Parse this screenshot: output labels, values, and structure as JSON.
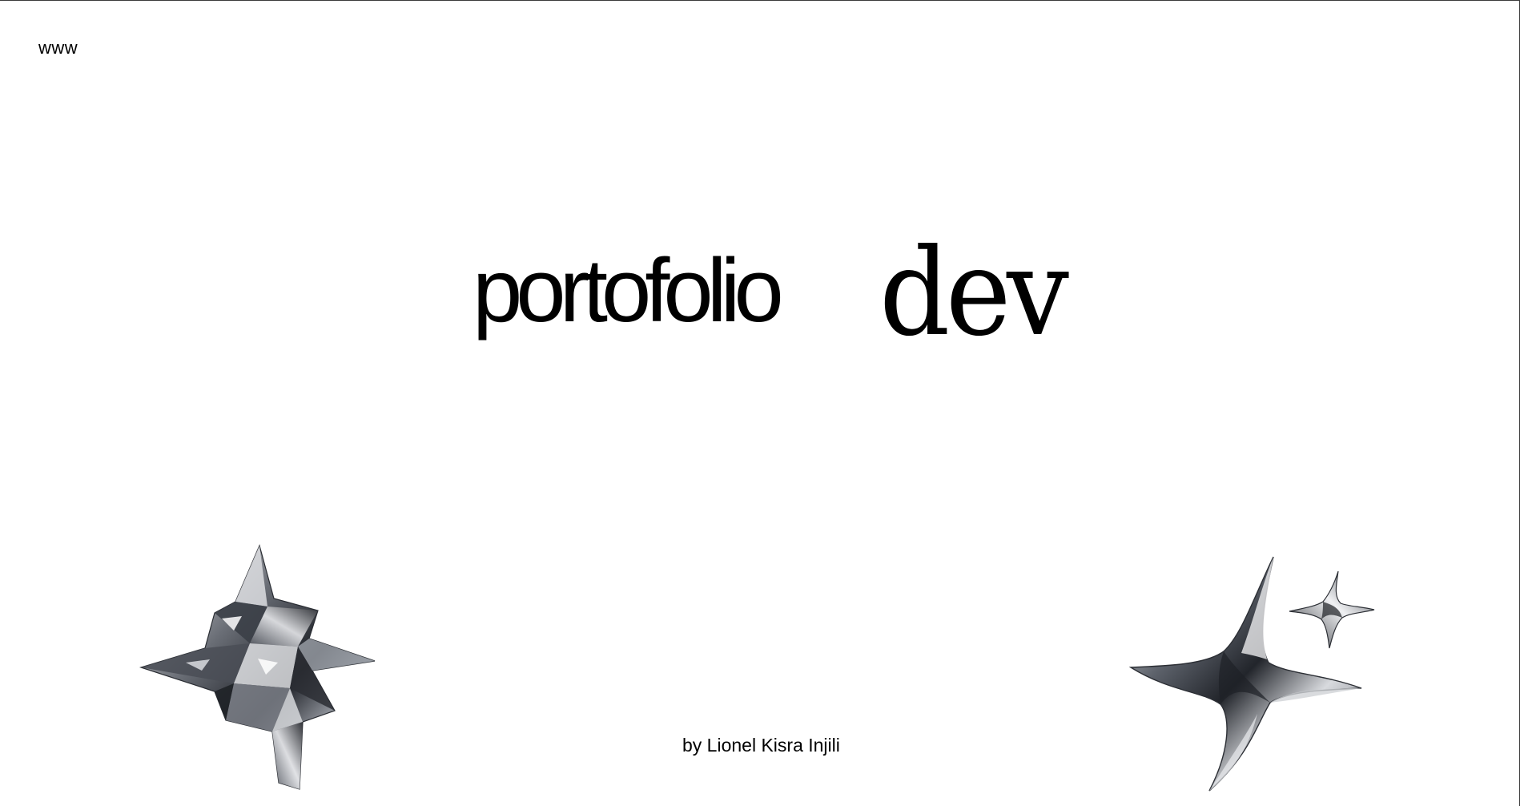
{
  "header": {
    "corner_label": "www"
  },
  "hero": {
    "word_one": "portofolio",
    "word_two": "dev"
  },
  "footer": {
    "credit": "by Lionel Kisra Injili"
  },
  "decorations": {
    "left_icon": "crystal-star-icon",
    "right_icon": "chrome-sparkle-icon"
  },
  "colors": {
    "background": "#ffffff",
    "text": "#000000"
  }
}
